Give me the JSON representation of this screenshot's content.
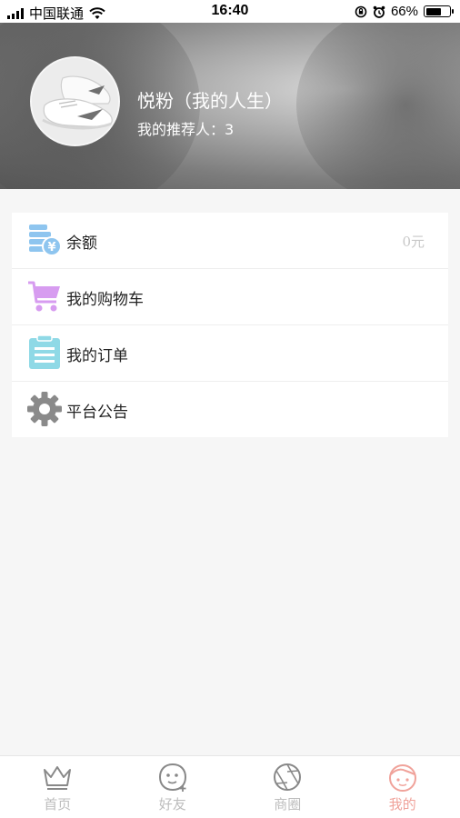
{
  "status_bar": {
    "carrier": "中国联通",
    "time": "16:40",
    "battery_percent": "66%",
    "battery_level": 0.66
  },
  "profile": {
    "name": "悦粉（我的人生）",
    "referrer": "我的推荐人：3"
  },
  "menu": {
    "items": [
      {
        "label": "余额",
        "value": "0元",
        "icon": "balance-coins-icon"
      },
      {
        "label": "我的购物车",
        "icon": "shopping-cart-icon"
      },
      {
        "label": "我的订单",
        "icon": "order-clipboard-icon"
      },
      {
        "label": "平台公告",
        "icon": "gear-icon"
      }
    ]
  },
  "tab_bar": {
    "tabs": [
      {
        "label": "首页",
        "icon": "crown-icon",
        "active": false
      },
      {
        "label": "好友",
        "icon": "friend-face-icon",
        "active": false
      },
      {
        "label": "商圈",
        "icon": "aperture-icon",
        "active": false
      },
      {
        "label": "我的",
        "icon": "profile-face-icon",
        "active": true
      }
    ]
  },
  "colors": {
    "accent": "#f0a29a",
    "tab_inactive": "#bdbdbd",
    "cart_purple": "#d79cf0",
    "balance_blue": "#8ec5ef",
    "order_teal": "#8fd9e6",
    "gear_gray": "#8a8a8a"
  }
}
